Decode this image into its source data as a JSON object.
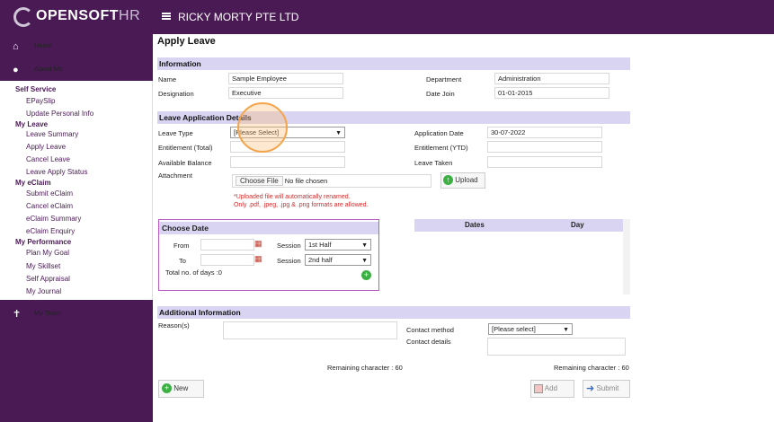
{
  "brand": {
    "logo_bold": "OPENSOFT",
    "logo_light": "HR"
  },
  "header": {
    "company": "RICKY MORTY PTE LTD"
  },
  "nav": {
    "home": "Home",
    "about": "About Me",
    "my_team": "My Team"
  },
  "menu": {
    "self_service": {
      "title": "Self Service",
      "items": [
        "EPaySlip",
        "Update Personal Info"
      ]
    },
    "my_leave": {
      "title": "My Leave",
      "items": [
        "Leave Summary",
        "Apply Leave",
        "Cancel Leave",
        "Leave Apply Status"
      ]
    },
    "my_eclaim": {
      "title": "My eClaim",
      "items": [
        "Submit eClaim",
        "Cancel eClaim",
        "eClaim Summary",
        "eClaim Enquiry"
      ]
    },
    "my_performance": {
      "title": "My Performance",
      "items": [
        "Plan My Goal",
        "My Skillset",
        "Self Appraisal",
        "My Journal"
      ]
    }
  },
  "page": {
    "title": "Apply Leave"
  },
  "information": {
    "heading": "Information",
    "name_label": "Name",
    "name": "Sample Employee",
    "department_label": "Department",
    "department": "Administration",
    "designation_label": "Designation",
    "designation": "Executive",
    "datejoin_label": "Date Join",
    "datejoin": "01-01-2015"
  },
  "leave_app": {
    "heading": "Leave Application Details",
    "leave_type_label": "Leave Type",
    "leave_type_value": "[Please Select]",
    "application_date_label": "Application Date",
    "application_date": "30-07-2022",
    "entitlement_total_label": "Entitlement (Total)",
    "entitlement_ytd_label": "Entitlement (YTD)",
    "available_balance_label": "Available Balance",
    "leave_taken_label": "Leave Taken",
    "attachment_label": "Attachment",
    "choose_file": "Choose File",
    "no_file": "No file chosen",
    "upload": "Upload",
    "note1": "*Uploaded file will automatically renamed.",
    "note2": "Only .pdf, .jpeg, .jpg & .png formats are allowed."
  },
  "choose_date": {
    "heading": "Choose Date",
    "from_label": "From",
    "to_label": "To",
    "session_label": "Session",
    "session_from": "1st Half",
    "session_to": "2nd half",
    "total_days": "Total no. of days :0"
  },
  "dates_table": {
    "col_dates": "Dates",
    "col_day": "Day"
  },
  "additional": {
    "heading": "Additional Information",
    "reasons_label": "Reason(s)",
    "contact_method_label": "Contact method",
    "contact_method_value": "[Please select]",
    "contact_details_label": "Contact details",
    "remaining1": "Remaining character : 60",
    "remaining2": "Remaining character : 60"
  },
  "actions": {
    "new": "New",
    "add": "Add",
    "submit": "Submit"
  }
}
